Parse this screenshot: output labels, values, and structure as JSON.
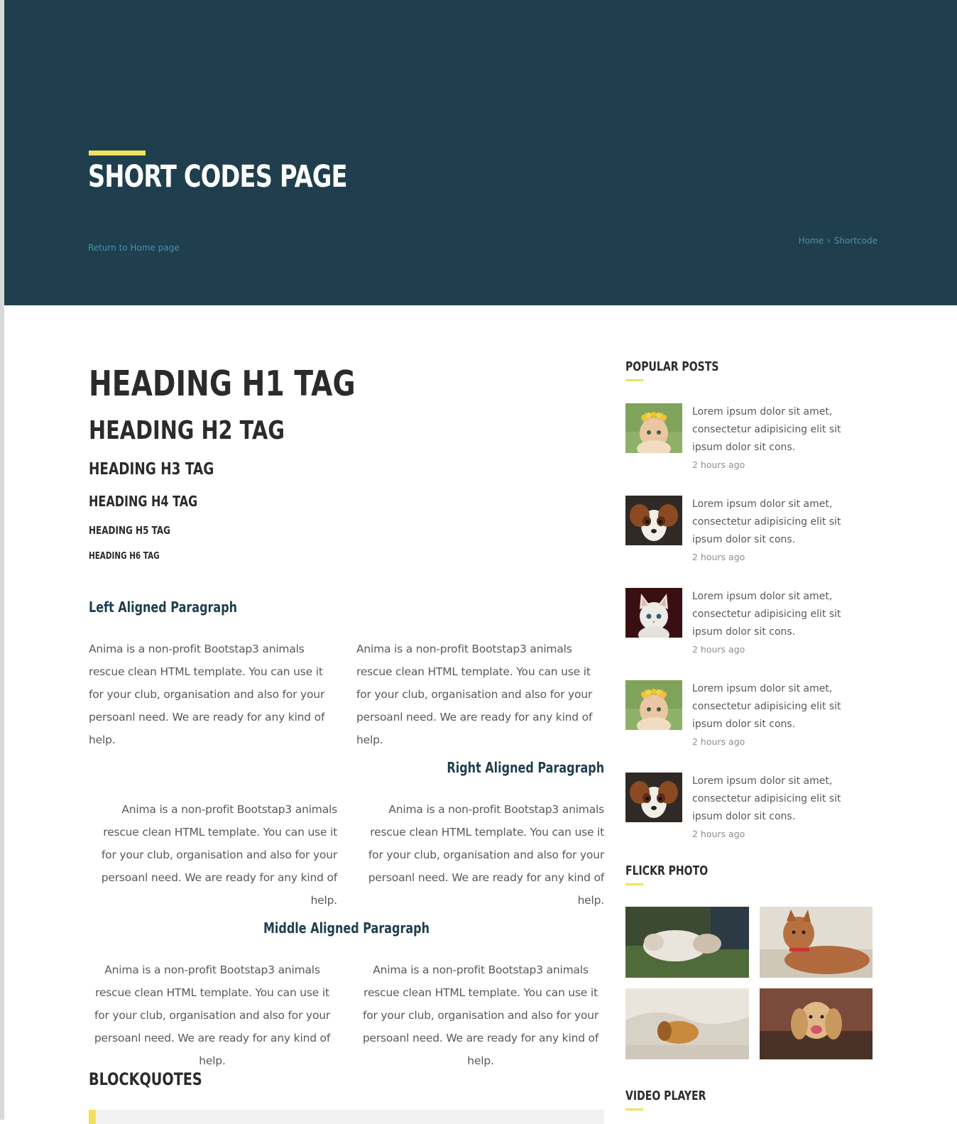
{
  "hero": {
    "title": "SHORT CODES PAGE",
    "return_link": "Return to Home page",
    "breadcrumb": [
      "Home",
      "Shortcode"
    ],
    "bg_color": "#1f3f4e",
    "accent_color": "#f0e15d"
  },
  "headings": {
    "h1": "HEADING H1 TAG",
    "h2": "HEADING H2 TAG",
    "h3": "HEADING H3 TAG",
    "h4": "HEADING H4 TAG",
    "h5": "HEADING H5 TAG",
    "h6": "HEADING H6 TAG"
  },
  "sections": {
    "left": {
      "title": "Left Aligned Paragraph",
      "paragraphs": [
        "Anima is a non-profit Bootstap3 animals rescue clean HTML template. You can use it for your club, organisation and also for your persoanl need. We are ready for any kind of help.",
        "Anima is a non-profit Bootstap3 animals rescue clean HTML template. You can use it for your club, organisation and also for your persoanl need. We are ready for any kind of help."
      ]
    },
    "right": {
      "title": "Right Aligned Paragraph",
      "paragraphs": [
        "Anima is a non-profit Bootstap3 animals rescue clean HTML template. You can use it for your club, organisation and also for your persoanl need. We are ready for any kind of help.",
        "Anima is a non-profit Bootstap3 animals rescue clean HTML template. You can use it for your club, organisation and also for your persoanl need. We are ready for any kind of help."
      ]
    },
    "middle": {
      "title": "Middle Aligned Paragraph",
      "paragraphs": [
        "Anima is a non-profit Bootstap3 animals rescue clean HTML template. You can use it for your club, organisation and also for your persoanl need. We are ready for any kind of help.",
        "Anima is a non-profit Bootstap3 animals rescue clean HTML template. You can use it for your club, organisation and also for your persoanl need. We are ready for any kind of help."
      ]
    },
    "blockquotes_title": "BLOCKQUOTES"
  },
  "sidebar": {
    "popular_title": "POPULAR POSTS",
    "posts": [
      {
        "text": "Lorem ipsum dolor sit amet, consectetur adipisicing elit sit ipsum dolor sit cons.",
        "time": "2 hours ago",
        "thumb": "kitten-flower-crown"
      },
      {
        "text": "Lorem ipsum dolor sit amet, consectetur adipisicing elit sit ipsum dolor sit cons.",
        "time": "2 hours ago",
        "thumb": "papillon-dog"
      },
      {
        "text": "Lorem ipsum dolor sit amet, consectetur adipisicing elit sit ipsum dolor sit cons.",
        "time": "2 hours ago",
        "thumb": "white-kitten"
      },
      {
        "text": "Lorem ipsum dolor sit amet, consectetur adipisicing elit sit ipsum dolor sit cons.",
        "time": "2 hours ago",
        "thumb": "kitten-flower-crown"
      },
      {
        "text": "Lorem ipsum dolor sit amet, consectetur adipisicing elit sit ipsum dolor sit cons.",
        "time": "2 hours ago",
        "thumb": "papillon-dog"
      }
    ],
    "flickr_title": "FLICKR PHOTO",
    "flickr_photos": [
      "cat-and-kitten-on-grass",
      "pitbull-on-couch",
      "puppy-under-blanket",
      "happy-spaniel"
    ],
    "video_title": "VIDEO PLAYER"
  }
}
